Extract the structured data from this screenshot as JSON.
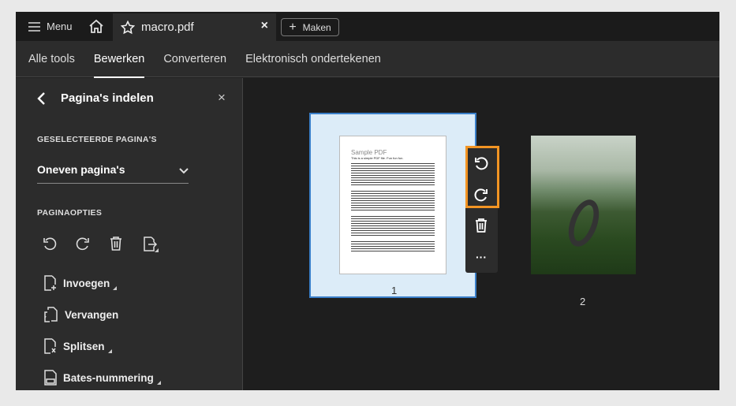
{
  "topbar": {
    "menu_label": "Menu",
    "tab_title": "macro.pdf",
    "new_label": "Maken"
  },
  "nav": {
    "items": [
      "Alle tools",
      "Bewerken",
      "Converteren",
      "Elektronisch ondertekenen"
    ],
    "active": "Bewerken"
  },
  "panel": {
    "title": "Pagina's indelen",
    "selected_heading": "GESELECTEERDE PAGINA'S",
    "selected_value": "Oneven pagina's",
    "options_heading": "PAGINAOPTIES",
    "actions": [
      "Invoegen",
      "Vervangen",
      "Splitsen",
      "Bates-nummering"
    ]
  },
  "pages": [
    {
      "number": "1",
      "title": "Sample PDF",
      "subtitle": "This is a simple PDF file. Fun fun fun."
    },
    {
      "number": "2"
    }
  ],
  "colors": {
    "accent_orange": "#f29423",
    "selection_blue": "#3a7fc9",
    "selection_bg": "#dcecf8"
  }
}
